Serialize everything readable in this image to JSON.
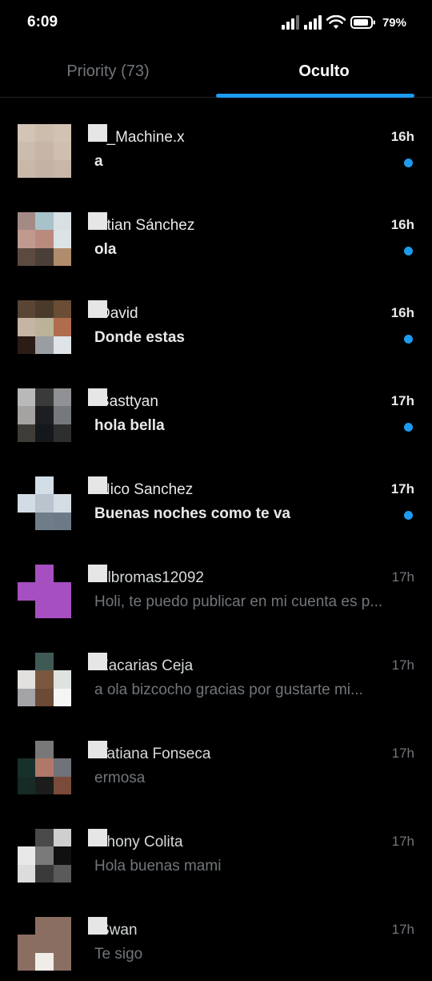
{
  "status_bar": {
    "time": "6:09",
    "battery_percent": "79%",
    "icons": [
      "signal-icon",
      "signal-icon",
      "wifi-icon",
      "battery-icon"
    ]
  },
  "tabs": [
    {
      "label": "Priority (73)",
      "active": false
    },
    {
      "label": "Oculto",
      "active": true
    }
  ],
  "colors": {
    "accent": "#1d9bf0",
    "background": "#000000",
    "text_primary": "#e7e9ea",
    "text_secondary": "#71767b"
  },
  "conversations": [
    {
      "name": "x_Machine.x",
      "preview": "a",
      "time": "16h",
      "unread": true,
      "avatar": [
        "#d4c4b6",
        "#cdbdad",
        "#d2c2b3",
        "#ccbcae",
        "#c7b6a7",
        "#cfbfb0",
        "#c9b8a8",
        "#c4b3a4",
        "#c8b7a9"
      ]
    },
    {
      "name": "stian Sánchez",
      "preview": "ola",
      "time": "16h",
      "unread": true,
      "avatar": [
        "#a48a84",
        "#a7c2c9",
        "#d9e0e3",
        "#c09a8f",
        "#b98a7d",
        "#dce3e6",
        "#5c4a40",
        "#4a3e38",
        "#b08c6c"
      ]
    },
    {
      "name": "David",
      "preview": "Donde estas",
      "time": "16h",
      "unread": true,
      "avatar": [
        "#5a4535",
        "#4a3a2a",
        "#6b4d35",
        "#c6b4a4",
        "#bcb29a",
        "#b06d4d",
        "#2b1c16",
        "#9a9ea2",
        "#dfe4e8"
      ]
    },
    {
      "name": "Basttyan",
      "preview": "hola bella",
      "time": "17h",
      "unread": true,
      "avatar": [
        "#b9b9b9",
        "#3a3a3a",
        "#8f9194",
        "#a5a3a1",
        "#1c1e22",
        "#76797c",
        "#3f3c38",
        "#14181c",
        "#2c2e30"
      ]
    },
    {
      "name": "Nico Sanchez",
      "preview": "Buenas noches como te va",
      "time": "17h",
      "unread": true,
      "avatar": [
        "#000000",
        "#d3dde6",
        "#000000",
        "#d3dce4",
        "#b9c4ce",
        "#d5dde4",
        "#000000",
        "#6f7d8a",
        "#6c7a88"
      ]
    },
    {
      "name": "elbromas12092",
      "preview": "Holi, te puedo publicar en mi cuenta es p...",
      "time": "17h",
      "unread": false,
      "avatar": [
        "#000000",
        "#a64fc0",
        "#000000",
        "#a64fc0",
        "#a64fc0",
        "#a64fc0",
        "#000000",
        "#a64fc0",
        "#a64fc0"
      ]
    },
    {
      "name": "Zacarias Ceja",
      "preview": "a ola bizcocho gracias por gustarte mi...",
      "time": "17h",
      "unread": false,
      "avatar": [
        "#000000",
        "#3f5a55",
        "#000000",
        "#e3e1df",
        "#7a5840",
        "#dfe3df",
        "#a3a3a8",
        "#6b4a36",
        "#f4f6f3"
      ]
    },
    {
      "name": "Tatiana Fonseca",
      "preview": "ermosa",
      "time": "17h",
      "unread": false,
      "avatar": [
        "#000000",
        "#787878",
        "#000000",
        "#18302c",
        "#b07868",
        "#70727a",
        "#162a26",
        "#1c1c1c",
        "#7a4a3a"
      ]
    },
    {
      "name": "Jhony Colita",
      "preview": "Hola buenas mami",
      "time": "17h",
      "unread": false,
      "avatar": [
        "#000000",
        "#4a4a4a",
        "#cfcfcf",
        "#e8e8e8",
        "#7a7a7a",
        "#101010",
        "#dcdcdc",
        "#3a3a3a",
        "#5a5a5a"
      ]
    },
    {
      "name": "Swan",
      "preview": "Te sigo",
      "time": "17h",
      "unread": false,
      "avatar": [
        "#000000",
        "#8a6e62",
        "#8a6e62",
        "#8a6e62",
        "#8a6e62",
        "#8a6e62",
        "#8a6e62",
        "#f0ece8",
        "#8a6e62"
      ]
    }
  ]
}
